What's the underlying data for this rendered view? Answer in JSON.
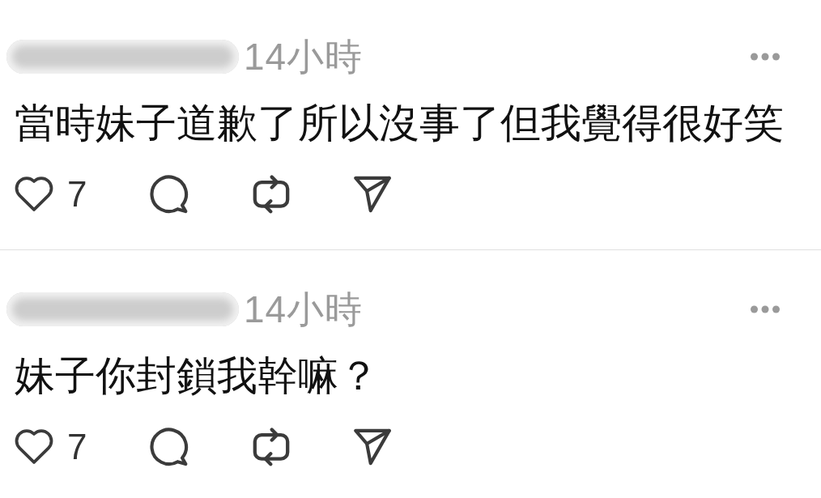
{
  "posts": [
    {
      "author": {
        "blurred": true
      },
      "time": "14小時",
      "text": "當時妹子道歉了所以沒事了但我覺得很好笑",
      "actions": [
        {
          "kind": "like",
          "liked": false,
          "count": "7"
        },
        {
          "kind": "comment"
        },
        {
          "kind": "repost"
        },
        {
          "kind": "share"
        }
      ]
    },
    {
      "author": {
        "blurred": true
      },
      "time": "14小時",
      "text": "妹子你封鎖我幹嘛？",
      "actions": [
        {
          "kind": "like",
          "liked": false,
          "count": "7"
        },
        {
          "kind": "comment"
        },
        {
          "kind": "repost"
        },
        {
          "kind": "share"
        }
      ]
    }
  ]
}
